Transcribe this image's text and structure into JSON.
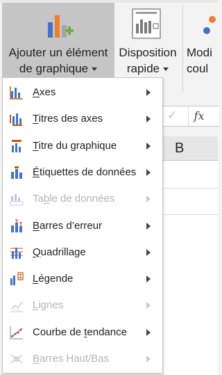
{
  "ribbon": {
    "add_element": {
      "line1": "Ajouter un élément",
      "line2": "de graphique"
    },
    "quick_layout": {
      "line1": "Disposition",
      "line2": "rapide"
    },
    "colors": {
      "line1": "Modi",
      "line2": "coul"
    }
  },
  "sheet": {
    "column_header": "B",
    "fx_label": "fx"
  },
  "menu": {
    "items": [
      {
        "pre": "",
        "key": "A",
        "post": "xes",
        "enabled": true,
        "icon": "axes-icon"
      },
      {
        "pre": "",
        "key": "T",
        "post": "itres des axes",
        "enabled": true,
        "icon": "axis-titles-icon"
      },
      {
        "pre": "",
        "key": "T",
        "post": "itre du graphique",
        "enabled": true,
        "icon": "chart-title-icon"
      },
      {
        "pre": "",
        "key": "É",
        "post": "tiquettes de données",
        "enabled": true,
        "icon": "data-labels-icon"
      },
      {
        "pre": "Ta",
        "key": "b",
        "post": "le de données",
        "enabled": false,
        "icon": "data-table-icon"
      },
      {
        "pre": "",
        "key": "B",
        "post": "arres d’erreur",
        "enabled": true,
        "icon": "error-bars-icon"
      },
      {
        "pre": "",
        "key": "Q",
        "post": "uadrillage",
        "enabled": true,
        "icon": "gridlines-icon"
      },
      {
        "pre": "",
        "key": "L",
        "post": "égende",
        "enabled": true,
        "icon": "legend-icon"
      },
      {
        "pre": "",
        "key": "L",
        "post": "ignes",
        "enabled": false,
        "icon": "lines-icon"
      },
      {
        "pre": "Courbe de ",
        "key": "t",
        "post": "endance",
        "enabled": true,
        "icon": "trendline-icon"
      },
      {
        "pre": "",
        "key": "B",
        "post": "arres Haut/Bas",
        "enabled": false,
        "icon": "up-down-bars-icon"
      }
    ]
  },
  "colors": {
    "accent": "#c55a11",
    "chart_blue": "#4472c4",
    "chart_green": "#70ad47",
    "disabled": "#b5b5b5"
  }
}
